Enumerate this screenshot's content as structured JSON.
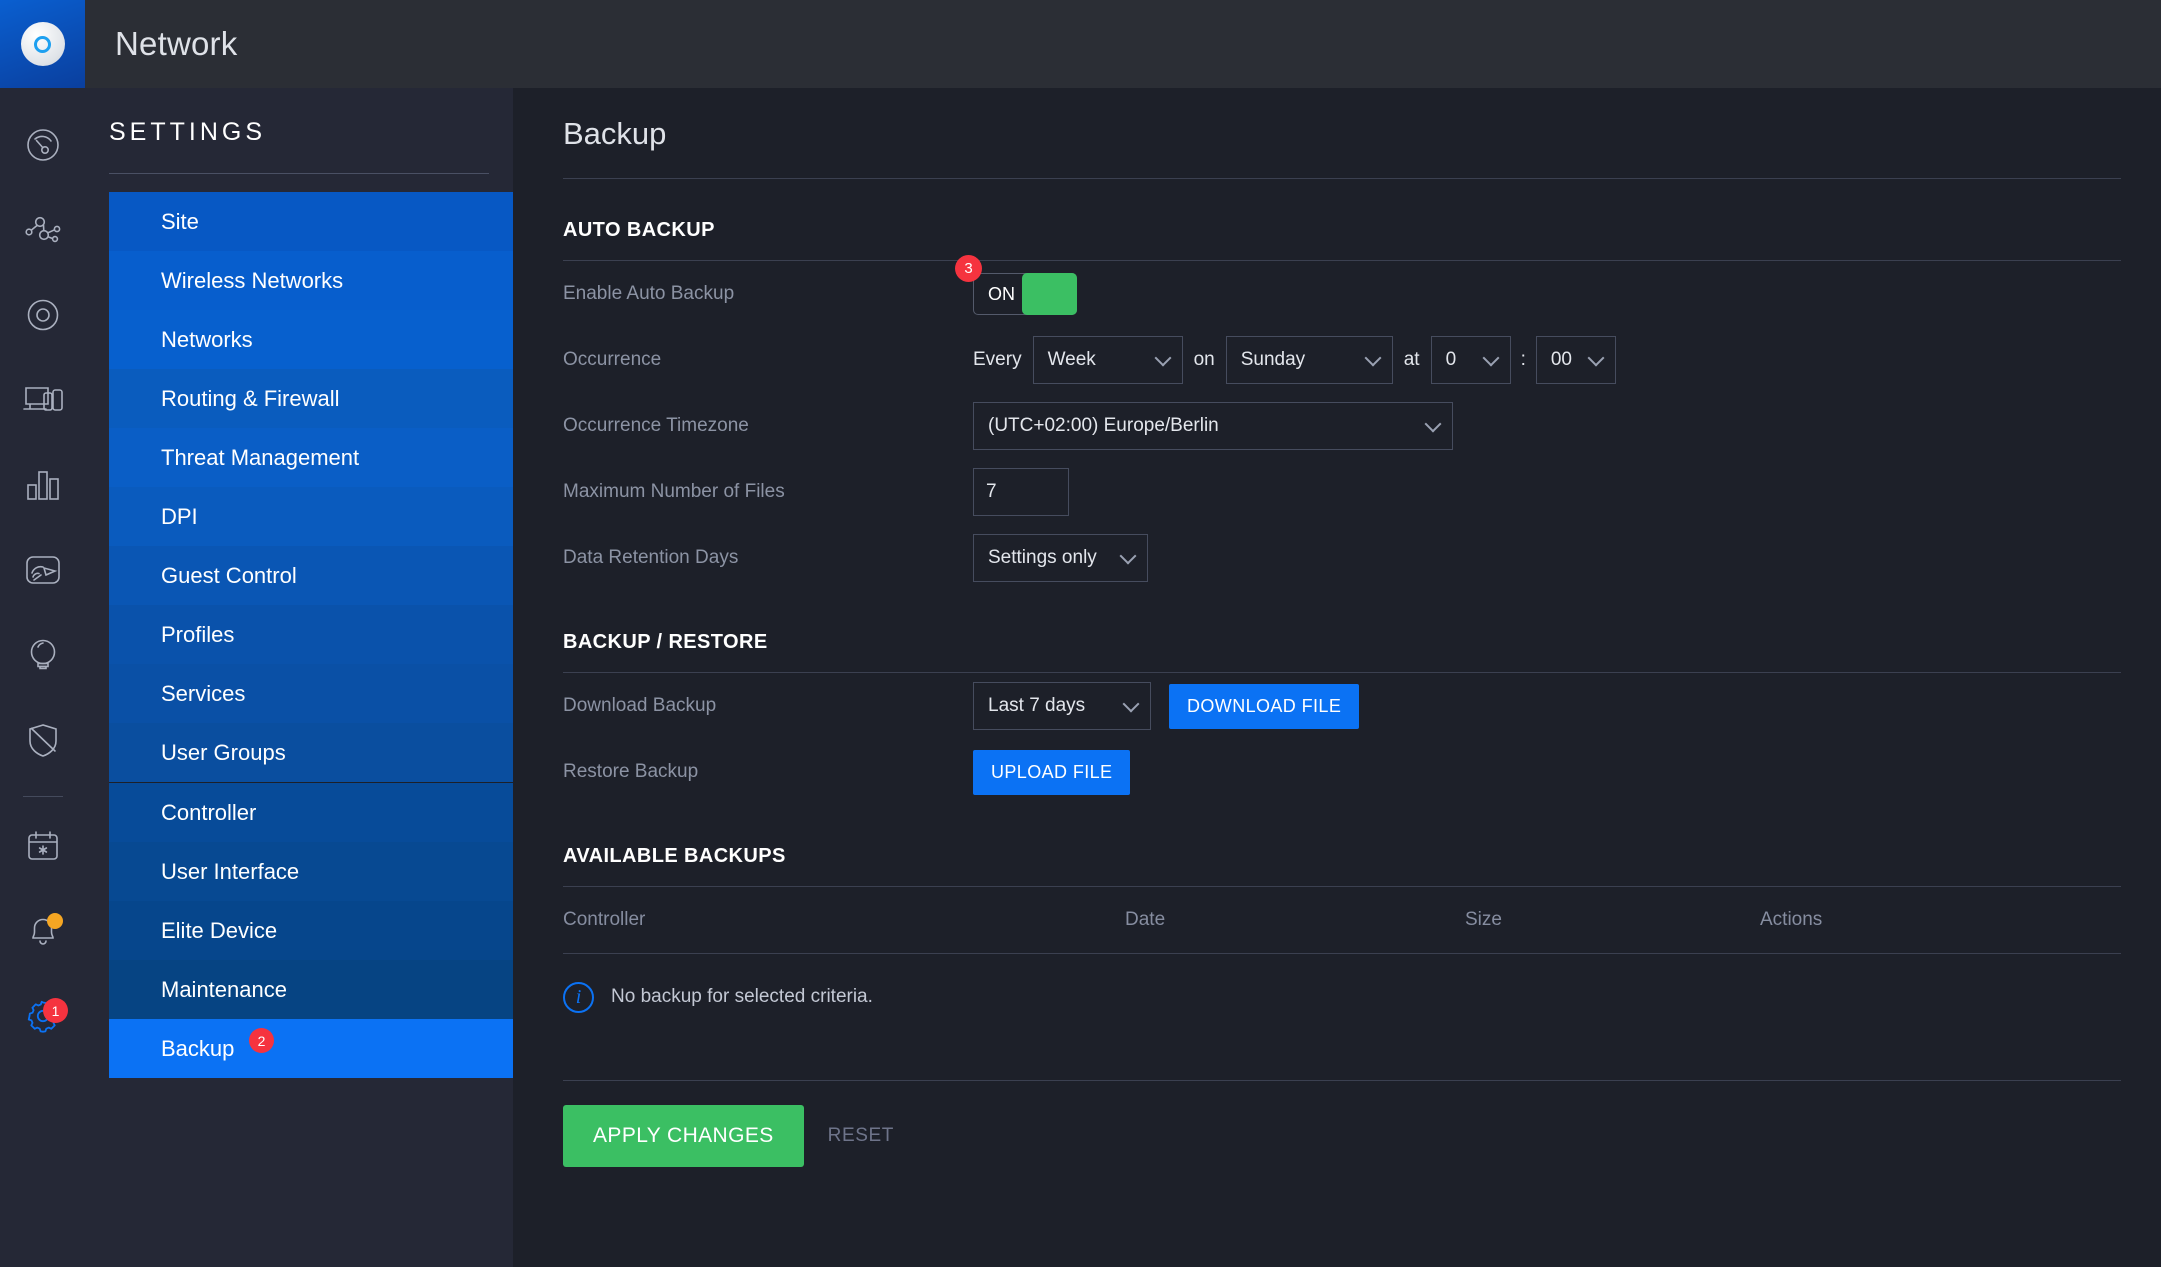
{
  "app": {
    "logo_icon": "unifi-disc-icon",
    "title": "Network"
  },
  "rail": {
    "items": [
      {
        "icon": "dashboard-gauge-icon",
        "name": "dashboard"
      },
      {
        "icon": "topology-icon",
        "name": "topology"
      },
      {
        "icon": "devices-disc-icon",
        "name": "devices"
      },
      {
        "icon": "clients-screens-icon",
        "name": "clients"
      },
      {
        "icon": "statistics-bars-icon",
        "name": "statistics"
      },
      {
        "icon": "insights-icon",
        "name": "insights"
      },
      {
        "icon": "hotspot-bulb-icon",
        "name": "hotspot"
      },
      {
        "icon": "shield-icon",
        "name": "threats"
      },
      {
        "icon": "events-calendar-icon",
        "name": "events"
      },
      {
        "icon": "alerts-bell-icon",
        "name": "alerts",
        "dot": ""
      },
      {
        "icon": "gear-icon",
        "name": "settings",
        "badge": "1"
      }
    ]
  },
  "sidebar": {
    "heading": "SETTINGS",
    "items": [
      {
        "label": "Site"
      },
      {
        "label": "Wireless Networks"
      },
      {
        "label": "Networks"
      },
      {
        "label": "Routing & Firewall"
      },
      {
        "label": "Threat Management"
      },
      {
        "label": "DPI"
      },
      {
        "label": "Guest Control"
      },
      {
        "label": "Profiles"
      },
      {
        "label": "Services"
      },
      {
        "label": "User Groups"
      },
      {
        "label": "Controller"
      },
      {
        "label": "User Interface"
      },
      {
        "label": "Elite Device"
      },
      {
        "label": "Maintenance"
      },
      {
        "label": "Backup",
        "badge": "2"
      }
    ]
  },
  "main": {
    "page_title": "Backup",
    "auto_backup": {
      "section_title": "AUTO BACKUP",
      "enable": {
        "label": "Enable Auto Backup",
        "toggle_state": "ON",
        "badge": "3"
      },
      "occurrence": {
        "label": "Occurrence",
        "word_every": "Every",
        "interval": "Week",
        "word_on": "on",
        "day": "Sunday",
        "word_at": "at",
        "hour": "0",
        "separator": ":",
        "minute": "00"
      },
      "timezone": {
        "label": "Occurrence Timezone",
        "value": "(UTC+02:00) Europe/Berlin"
      },
      "max_files": {
        "label": "Maximum Number of Files",
        "value": "7"
      },
      "retention": {
        "label": "Data Retention Days",
        "value": "Settings only"
      }
    },
    "backup_restore": {
      "section_title": "BACKUP / RESTORE",
      "download": {
        "label": "Download Backup",
        "range": "Last 7 days",
        "button": "DOWNLOAD FILE"
      },
      "restore": {
        "label": "Restore Backup",
        "button": "UPLOAD FILE"
      }
    },
    "available_backups": {
      "section_title": "AVAILABLE BACKUPS",
      "columns": [
        "Controller",
        "Date",
        "Size",
        "Actions"
      ],
      "empty_message": "No backup for selected criteria.",
      "rows": []
    },
    "footer": {
      "apply": "APPLY CHANGES",
      "reset": "RESET"
    }
  },
  "colors": {
    "accent_blue": "#0b72f4",
    "active_menu_blue": "#0b72f4",
    "success_green": "#3bbf63",
    "badge_red": "#f5333f",
    "dot_orange": "#f5a623",
    "panel_bg": "#1d2029",
    "sidebar_bg": "#252836",
    "topbar_bg": "#2b2e35"
  }
}
